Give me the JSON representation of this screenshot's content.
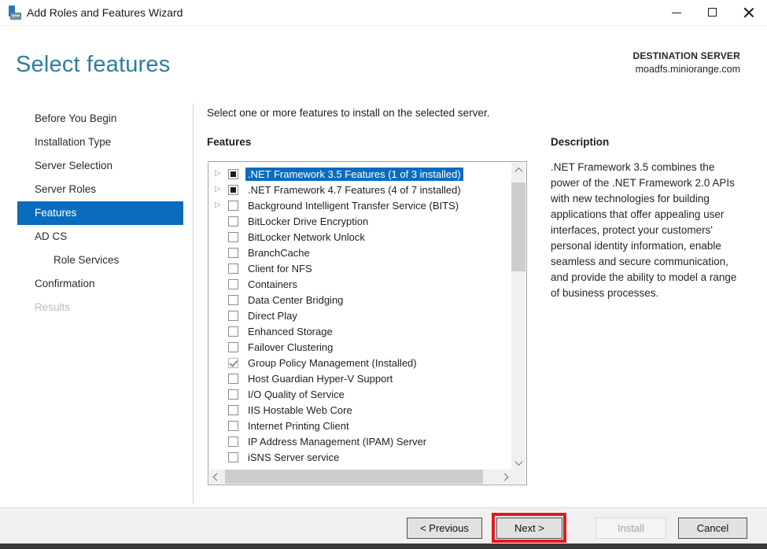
{
  "window": {
    "title": "Add Roles and Features Wizard"
  },
  "header": {
    "title": "Select features",
    "destination_label": "DESTINATION SERVER",
    "destination_server": "moadfs.miniorange.com"
  },
  "sidebar": {
    "items": [
      {
        "label": "Before You Begin",
        "state": "normal"
      },
      {
        "label": "Installation Type",
        "state": "normal"
      },
      {
        "label": "Server Selection",
        "state": "normal"
      },
      {
        "label": "Server Roles",
        "state": "normal"
      },
      {
        "label": "Features",
        "state": "selected"
      },
      {
        "label": "AD CS",
        "state": "normal"
      },
      {
        "label": "Role Services",
        "state": "normal",
        "indent": true
      },
      {
        "label": "Confirmation",
        "state": "normal"
      },
      {
        "label": "Results",
        "state": "disabled"
      }
    ]
  },
  "main": {
    "instruction": "Select one or more features to install on the selected server.",
    "features_label": "Features",
    "features": [
      {
        "label": ".NET Framework 3.5 Features (1 of 3 installed)",
        "checkbox": "indeterminate",
        "expandable": true,
        "selected": true
      },
      {
        "label": ".NET Framework 4.7 Features (4 of 7 installed)",
        "checkbox": "indeterminate",
        "expandable": true,
        "selected": false
      },
      {
        "label": "Background Intelligent Transfer Service (BITS)",
        "checkbox": "unchecked",
        "expandable": true,
        "selected": false
      },
      {
        "label": "BitLocker Drive Encryption",
        "checkbox": "unchecked",
        "expandable": false,
        "selected": false
      },
      {
        "label": "BitLocker Network Unlock",
        "checkbox": "unchecked",
        "expandable": false,
        "selected": false
      },
      {
        "label": "BranchCache",
        "checkbox": "unchecked",
        "expandable": false,
        "selected": false
      },
      {
        "label": "Client for NFS",
        "checkbox": "unchecked",
        "expandable": false,
        "selected": false
      },
      {
        "label": "Containers",
        "checkbox": "unchecked",
        "expandable": false,
        "selected": false
      },
      {
        "label": "Data Center Bridging",
        "checkbox": "unchecked",
        "expandable": false,
        "selected": false
      },
      {
        "label": "Direct Play",
        "checkbox": "unchecked",
        "expandable": false,
        "selected": false
      },
      {
        "label": "Enhanced Storage",
        "checkbox": "unchecked",
        "expandable": false,
        "selected": false
      },
      {
        "label": "Failover Clustering",
        "checkbox": "unchecked",
        "expandable": false,
        "selected": false
      },
      {
        "label": "Group Policy Management (Installed)",
        "checkbox": "checked-installed",
        "expandable": false,
        "selected": false
      },
      {
        "label": "Host Guardian Hyper-V Support",
        "checkbox": "unchecked",
        "expandable": false,
        "selected": false
      },
      {
        "label": "I/O Quality of Service",
        "checkbox": "unchecked",
        "expandable": false,
        "selected": false
      },
      {
        "label": "IIS Hostable Web Core",
        "checkbox": "unchecked",
        "expandable": false,
        "selected": false
      },
      {
        "label": "Internet Printing Client",
        "checkbox": "unchecked",
        "expandable": false,
        "selected": false
      },
      {
        "label": "IP Address Management (IPAM) Server",
        "checkbox": "unchecked",
        "expandable": false,
        "selected": false
      },
      {
        "label": "iSNS Server service",
        "checkbox": "unchecked",
        "expandable": false,
        "selected": false
      }
    ],
    "expander_glyph": "▷"
  },
  "description": {
    "heading": "Description",
    "text": ".NET Framework 3.5 combines the power of the .NET Framework 2.0 APIs with new technologies for building applications that offer appealing user interfaces, protect your customers' personal identity information, enable seamless and secure communication, and provide the ability to model a range of business processes."
  },
  "footer": {
    "buttons": [
      {
        "label": "< Previous",
        "state": "enabled"
      },
      {
        "label": "Next >",
        "state": "enabled",
        "highlighted": true
      },
      {
        "label": "Install",
        "state": "disabled"
      },
      {
        "label": "Cancel",
        "state": "enabled"
      }
    ]
  },
  "colors": {
    "accent_blue": "#0b6cbd",
    "title_teal": "#2e7d9e",
    "annotation_red": "#e2191f",
    "footer_gray": "#f0f0f0",
    "scroll_thumb": "#cdcdcd"
  }
}
